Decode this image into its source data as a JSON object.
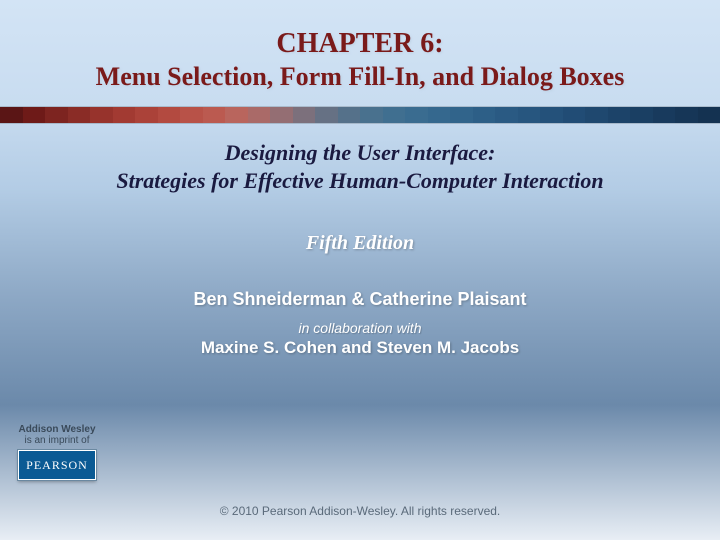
{
  "header": {
    "chapter": "CHAPTER 6:",
    "subtitle": "Menu Selection, Form Fill-In, and Dialog Boxes"
  },
  "stripe_colors": [
    "#5a1515",
    "#6e1a18",
    "#7d2420",
    "#8a2c26",
    "#97332c",
    "#a23a32",
    "#ab4239",
    "#b34a40",
    "#b85248",
    "#bb5a50",
    "#b9655d",
    "#aa6a68",
    "#946e73",
    "#7c707c",
    "#667184",
    "#55718a",
    "#49718e",
    "#406f90",
    "#3a6c90",
    "#35688e",
    "#31648b",
    "#2d5f87",
    "#2a5a83",
    "#27567f",
    "#24517a",
    "#214c75",
    "#1f486f",
    "#1c4369",
    "#1a3f63",
    "#183a5d",
    "#163657",
    "#143251"
  ],
  "book": {
    "title": "Designing the User Interface:",
    "subtitle": "Strategies for Effective Human-Computer Interaction",
    "edition": "Fifth Edition",
    "authors": "Ben Shneiderman & Catherine Plaisant",
    "collab_label": "in collaboration with",
    "coauthors": "Maxine S. Cohen and Steven M. Jacobs"
  },
  "imprint": {
    "line1": "Addison Wesley",
    "line2": "is an imprint of",
    "logo_text": "PEARSON"
  },
  "copyright": "© 2010 Pearson Addison-Wesley. All rights reserved."
}
